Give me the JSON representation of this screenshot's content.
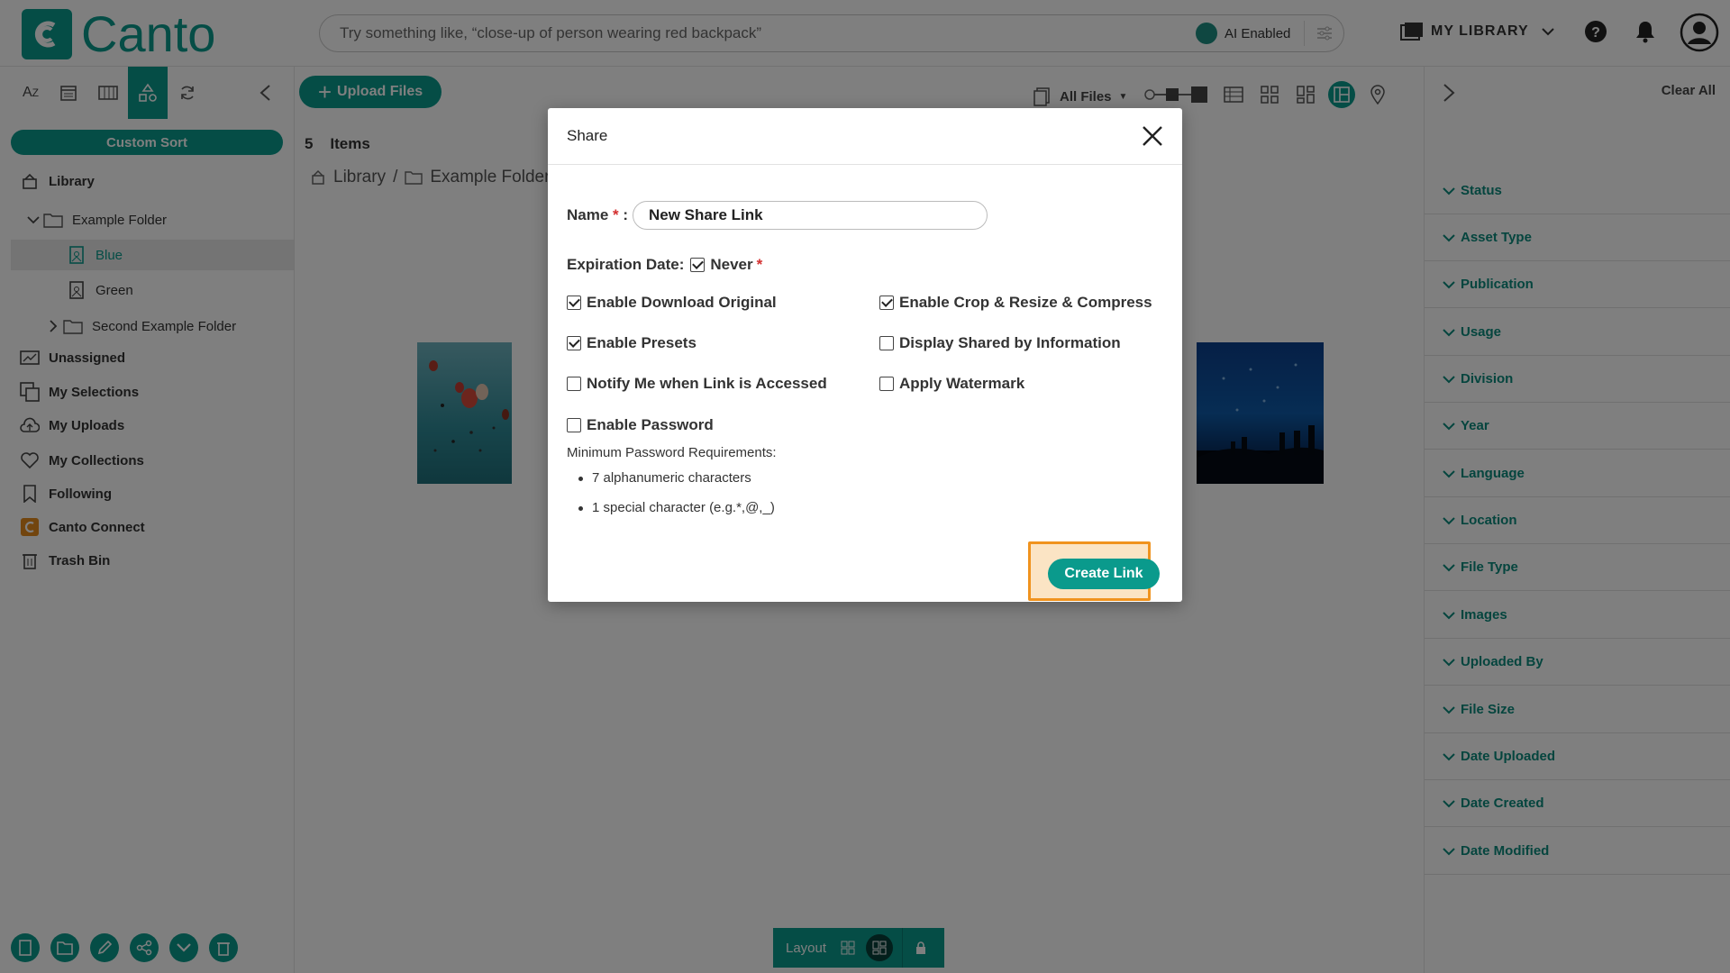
{
  "header": {
    "logo_text": "Canto",
    "search_placeholder": "Try something like, “close-up of person wearing red backpack”",
    "ai_label": "AI Enabled",
    "library_label": "MY LIBRARY"
  },
  "left_sidebar": {
    "custom_sort_label": "Custom Sort",
    "tree": {
      "library": "Library",
      "example_folder": "Example Folder",
      "blue": "Blue",
      "green": "Green",
      "second_example_folder": "Second Example Folder",
      "unassigned": "Unassigned",
      "my_selections": "My Selections",
      "my_uploads": "My Uploads",
      "my_collections": "My Collections",
      "following": "Following",
      "canto_connect": "Canto Connect",
      "trash_bin": "Trash Bin"
    }
  },
  "main": {
    "upload_label": "Upload Files",
    "all_files_label": "All Files",
    "items_count": "5",
    "items_label": "Items",
    "breadcrumb": [
      "Library",
      "/",
      "Example Folder",
      "/"
    ],
    "layout_label": "Layout"
  },
  "right_sidebar": {
    "clear_all": "Clear All",
    "filters": [
      "Status",
      "Asset Type",
      "Publication",
      "Usage",
      "Division",
      "Year",
      "Language",
      "Location",
      "File Type",
      "Images",
      "Uploaded By",
      "File Size",
      "Date Uploaded",
      "Date Created",
      "Date Modified"
    ]
  },
  "modal": {
    "title": "Share",
    "name_label": "Name",
    "name_value": "New Share Link",
    "expiration_label": "Expiration Date:",
    "never_label": "Never",
    "options": {
      "download_original": "Enable Download Original",
      "crop_resize": "Enable Crop & Resize & Compress",
      "presets": "Enable Presets",
      "shared_by": "Display Shared by Information",
      "notify": "Notify Me when Link is Accessed",
      "watermark": "Apply Watermark",
      "password": "Enable Password"
    },
    "password_requirements_label": "Minimum Password Requirements:",
    "password_requirements": [
      "7 alphanumeric characters",
      "1 special character (e.g.*,@,_)"
    ],
    "create_label": "Create Link"
  },
  "colors": {
    "brand": "#0a9a8c",
    "highlight": "#f0931e",
    "required": "#d32f2f"
  }
}
